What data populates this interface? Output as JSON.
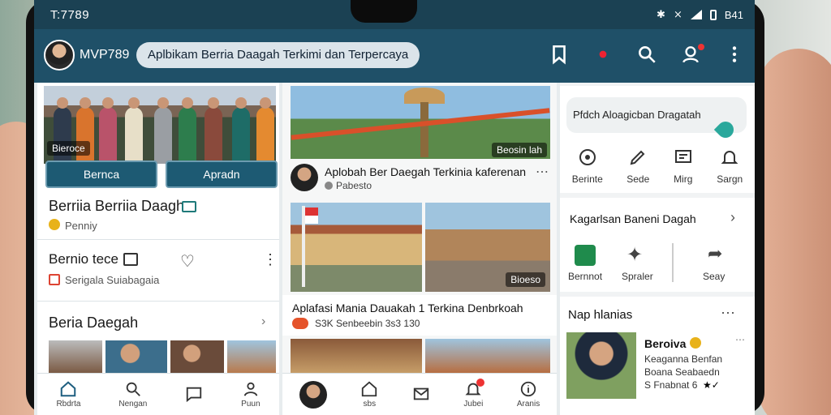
{
  "status": {
    "time": "T:7789",
    "battery": "B41"
  },
  "appbar": {
    "username": "MVP789",
    "app_title": "Aplbikam Berria Daagah Terkimi dan Terpercaya"
  },
  "col1": {
    "hero_label": "Bieroce",
    "buttons": [
      "Bernca",
      "Apradn"
    ],
    "headline": "Berriia Berriia Daagh",
    "headline_sub": "Penniy",
    "row2_title": "Bernio tece",
    "row2_sub": "Serigala Suiabagaia",
    "section_title": "Beria Daegah"
  },
  "col2": {
    "hero_label": "Beosin lah",
    "article1_title": "Aplobah Ber Daegah Terkinia kaferenan",
    "article1_meta": "Pabesto",
    "photo_label": "Bioeso",
    "article2_title": "Aplafasi Mania Dauakah 1 Terkina Denbrkoah",
    "article2_meta": "S3K  Senbeebin  3s3 130"
  },
  "col3": {
    "search_text": "Pfdch Aloagicban Dragatah",
    "quick": [
      "Berinte",
      "Sede",
      "Mirg",
      "Sargn"
    ],
    "card_title": "Kagarlsan Baneni Dagah",
    "actions": [
      "Bernnot",
      "Spraler",
      "Seay"
    ],
    "section_title": "Nap hlanias",
    "person_name": "Beroiva",
    "person_lines": [
      "Keaganna Benfan",
      "Boana Seabaedn",
      "S Fnabnat 6"
    ]
  },
  "nav_left": [
    "Rbdrta",
    "Nengan",
    "",
    "Puun"
  ],
  "nav_mid": [
    "sbs",
    "",
    "Jubei",
    "Aranis"
  ]
}
